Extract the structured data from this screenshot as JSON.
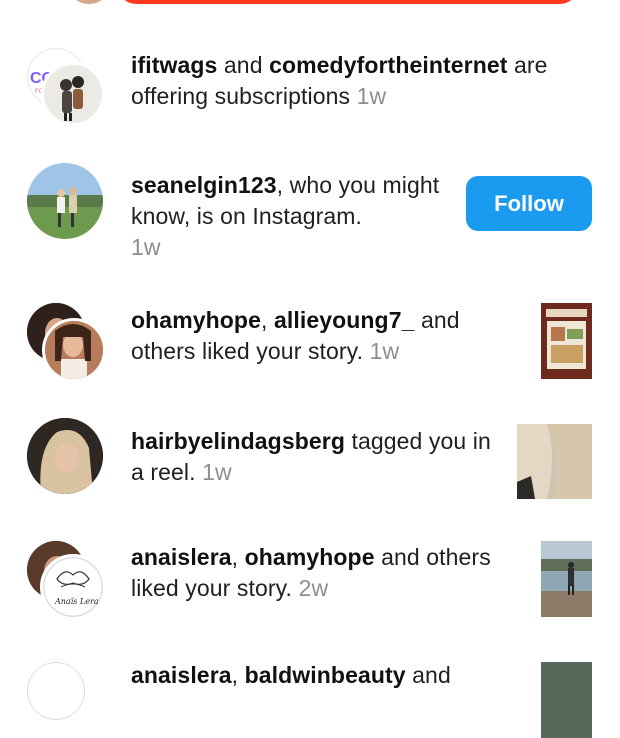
{
  "notifications": [
    {
      "user1": "ifitwags",
      "joiner": " and ",
      "user2": "comedyfortheinternet",
      "text": " are offering subscriptions",
      "time": "1w",
      "logo_text": "CO",
      "logo_sub": "FO"
    },
    {
      "user1": "seanelgin123",
      "text": ", who you might know, is on Instagram.",
      "time": "1w",
      "follow_label": "Follow"
    },
    {
      "user1": "ohamyhope",
      "joiner": ", ",
      "user2": "allieyoung7_",
      "text": " and others liked your story.",
      "time": "1w"
    },
    {
      "user1": "hairbyelindagsberg",
      "text": " tagged you in a reel.",
      "time": "1w"
    },
    {
      "user1": "anaislera",
      "joiner": ", ",
      "user2": "ohamyhope",
      "text": " and others liked your story.",
      "time": "2w",
      "signature": "Anaïs Lera"
    },
    {
      "user1": "anaislera",
      "joiner": ", ",
      "user2": "baldwinbeauty",
      "text": " and"
    }
  ],
  "colors": {
    "accent_red": "#ff3b1f",
    "follow_blue": "#1a9bf0",
    "muted": "#8e8e8e"
  }
}
